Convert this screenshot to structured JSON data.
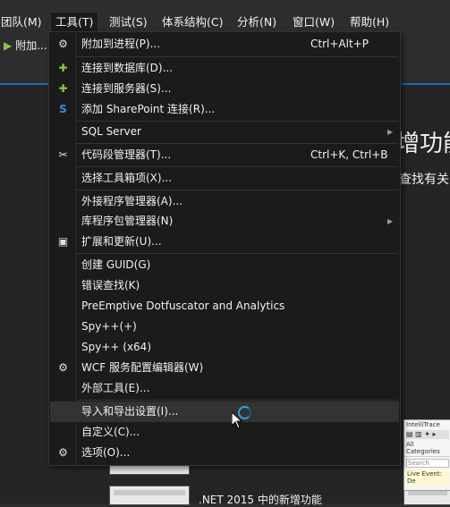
{
  "menubar": {
    "items": [
      {
        "label": "团队(M)"
      },
      {
        "label": "工具(T)"
      },
      {
        "label": "测试(S)"
      },
      {
        "label": "体系结构(C)"
      },
      {
        "label": "分析(N)"
      },
      {
        "label": "窗口(W)"
      },
      {
        "label": "帮助(H)"
      }
    ]
  },
  "toolbar": {
    "attach_label": "附加..."
  },
  "background": {
    "heading": "增功能",
    "subtext": "查找有关",
    "news_title": ".NET 2015 中的新增功能",
    "side_panel": {
      "title": "IntelliTrace",
      "categories": "All Categories",
      "search": "Search",
      "live_event": "Live Event: De"
    }
  },
  "tools_menu": {
    "items": [
      {
        "label": "附加到进程(P)...",
        "shortcut": "Ctrl+Alt+P",
        "icon": "attach-process-icon"
      },
      {
        "label": "连接到数据库(D)...",
        "icon": "connect-database-icon"
      },
      {
        "label": "连接到服务器(S)...",
        "icon": "connect-server-icon"
      },
      {
        "label": "添加 SharePoint 连接(R)...",
        "icon": "sharepoint-icon"
      },
      {
        "label": "SQL Server",
        "submenu": true
      },
      {
        "label": "代码段管理器(T)...",
        "shortcut": "Ctrl+K, Ctrl+B",
        "icon": "code-snippet-icon"
      },
      {
        "label": "选择工具箱项(X)..."
      },
      {
        "label": "外接程序管理器(A)..."
      },
      {
        "label": "库程序包管理器(N)",
        "submenu": true
      },
      {
        "label": "扩展和更新(U)...",
        "icon": "extensions-icon"
      },
      {
        "label": "创建 GUID(G)"
      },
      {
        "label": "错误查找(K)"
      },
      {
        "label": "PreEmptive Dotfuscator and Analytics"
      },
      {
        "label": "Spy++(+)"
      },
      {
        "label": "Spy++ (x64)"
      },
      {
        "label": "WCF 服务配置编辑器(W)",
        "icon": "wcf-config-icon"
      },
      {
        "label": "外部工具(E)..."
      },
      {
        "label": "导入和导出设置(I)...",
        "hovered": true
      },
      {
        "label": "自定义(C)..."
      },
      {
        "label": "选项(O)...",
        "icon": "gear-icon"
      }
    ]
  },
  "colors": {
    "accent": "#1b6bb6",
    "menu_bg": "#1b1b1c",
    "hover_bg": "#333334",
    "spinner": "#2ba7d6"
  }
}
